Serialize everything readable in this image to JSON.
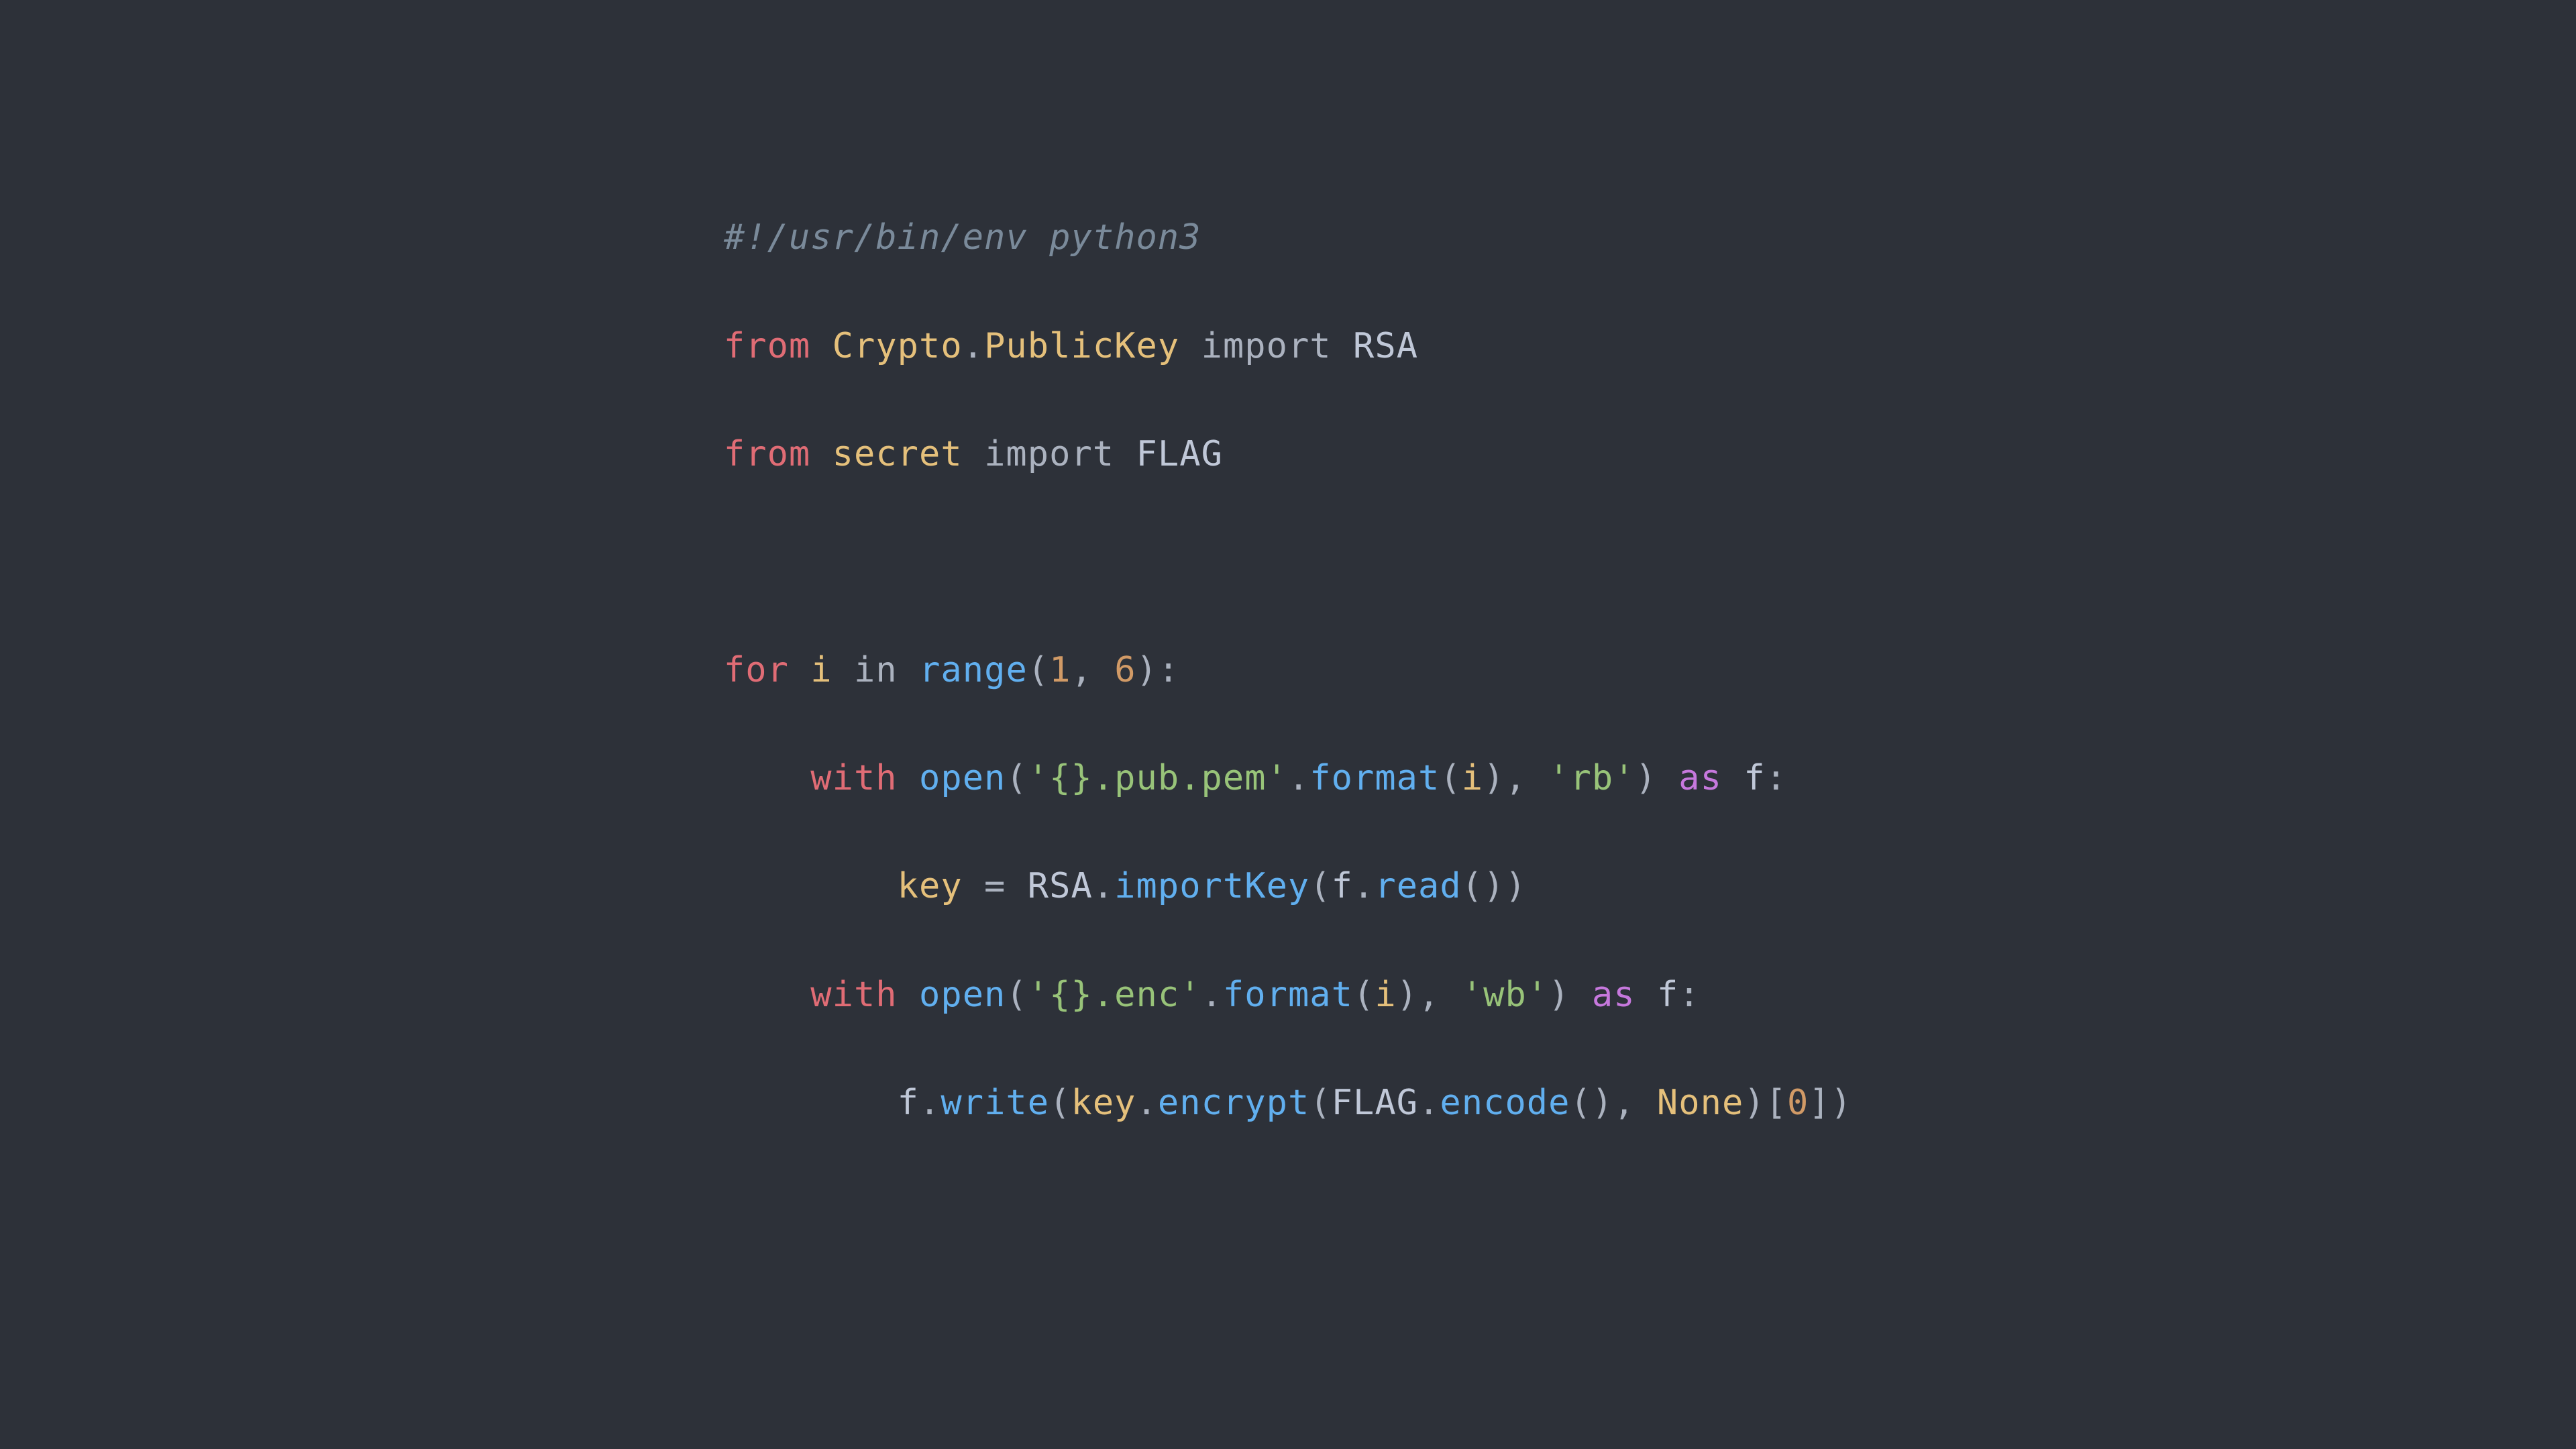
{
  "background": "#2d3139",
  "code": {
    "lines": [
      {
        "id": "shebang",
        "text": "#!/usr/bin/env python3"
      },
      {
        "id": "import1",
        "text": "from Crypto.PublicKey import RSA"
      },
      {
        "id": "import2",
        "text": "from secret import FLAG"
      },
      {
        "id": "blank1",
        "text": ""
      },
      {
        "id": "for",
        "text": "for i in range(1, 6):"
      },
      {
        "id": "with1",
        "text": "    with open('{}.pub.pem'.format(i), 'rb') as f:"
      },
      {
        "id": "key",
        "text": "        key = RSA.importKey(f.read())"
      },
      {
        "id": "with2",
        "text": "    with open('{}.enc'.format(i), 'wb') as f:"
      },
      {
        "id": "fwrite",
        "text": "        f.write(key.encrypt(FLAG.encode(), None)[0])"
      }
    ]
  }
}
